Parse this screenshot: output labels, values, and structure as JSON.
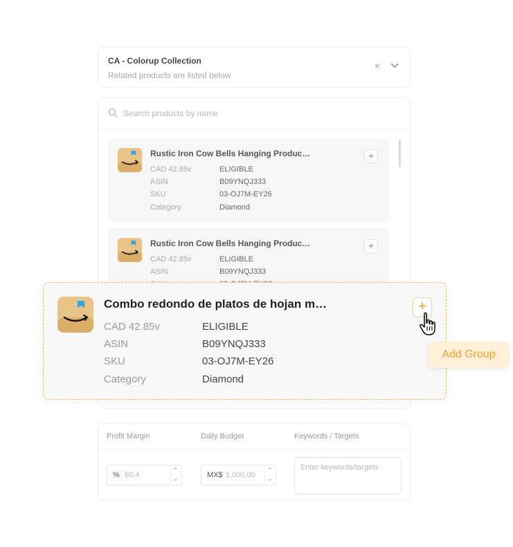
{
  "collection": {
    "title": "CA - Colorup Collection",
    "subtitle": "Related products are listed below",
    "clear": "×"
  },
  "search": {
    "placeholder": "Search products by name"
  },
  "products": [
    {
      "name": "Rustic Iron Cow Bells Hanging Produc…",
      "rows": [
        {
          "k": "CAD 42.85v",
          "v": "ELIGIBLE"
        },
        {
          "k": "ASIN",
          "v": "B09YNQJ333"
        },
        {
          "k": "SKU",
          "v": "03-OJ7M-EY26"
        },
        {
          "k": "Category",
          "v": "Diamond"
        }
      ],
      "plus": "+"
    },
    {
      "name": "Rustic Iron Cow Bells Hanging Produc…",
      "rows": [
        {
          "k": "CAD 42.85v",
          "v": "ELIGIBLE"
        },
        {
          "k": "ASIN",
          "v": "B09YNQJ333"
        },
        {
          "k": "SKU",
          "v": "03-OJ7M-EY26"
        }
      ],
      "plus": "+"
    }
  ],
  "highlight": {
    "name": "Combo redondo de platos de hojan m…",
    "rows": [
      {
        "k": "CAD 42.85v",
        "v": "ELIGIBLE"
      },
      {
        "k": "ASIN",
        "v": "B09YNQJ333"
      },
      {
        "k": "SKU",
        "v": "03-OJ7M-EY26"
      },
      {
        "k": "Category",
        "v": "Diamond"
      }
    ],
    "plus": "+"
  },
  "add_group": "Add Group",
  "settings": {
    "profit_margin_label": "Profit Margin",
    "daily_budget_label": "Daily Budget",
    "keywords_label": "Keywords / Targets",
    "profit_prefix": "%",
    "profit_value": "60,4",
    "budget_prefix": "MX$",
    "budget_value": "1,000.00",
    "keywords_placeholder": "Enter keywords/targets"
  },
  "colors": {
    "accent": "#f0a020",
    "accent_bg": "#fdf0d6",
    "dashed_border": "#f4b860"
  }
}
